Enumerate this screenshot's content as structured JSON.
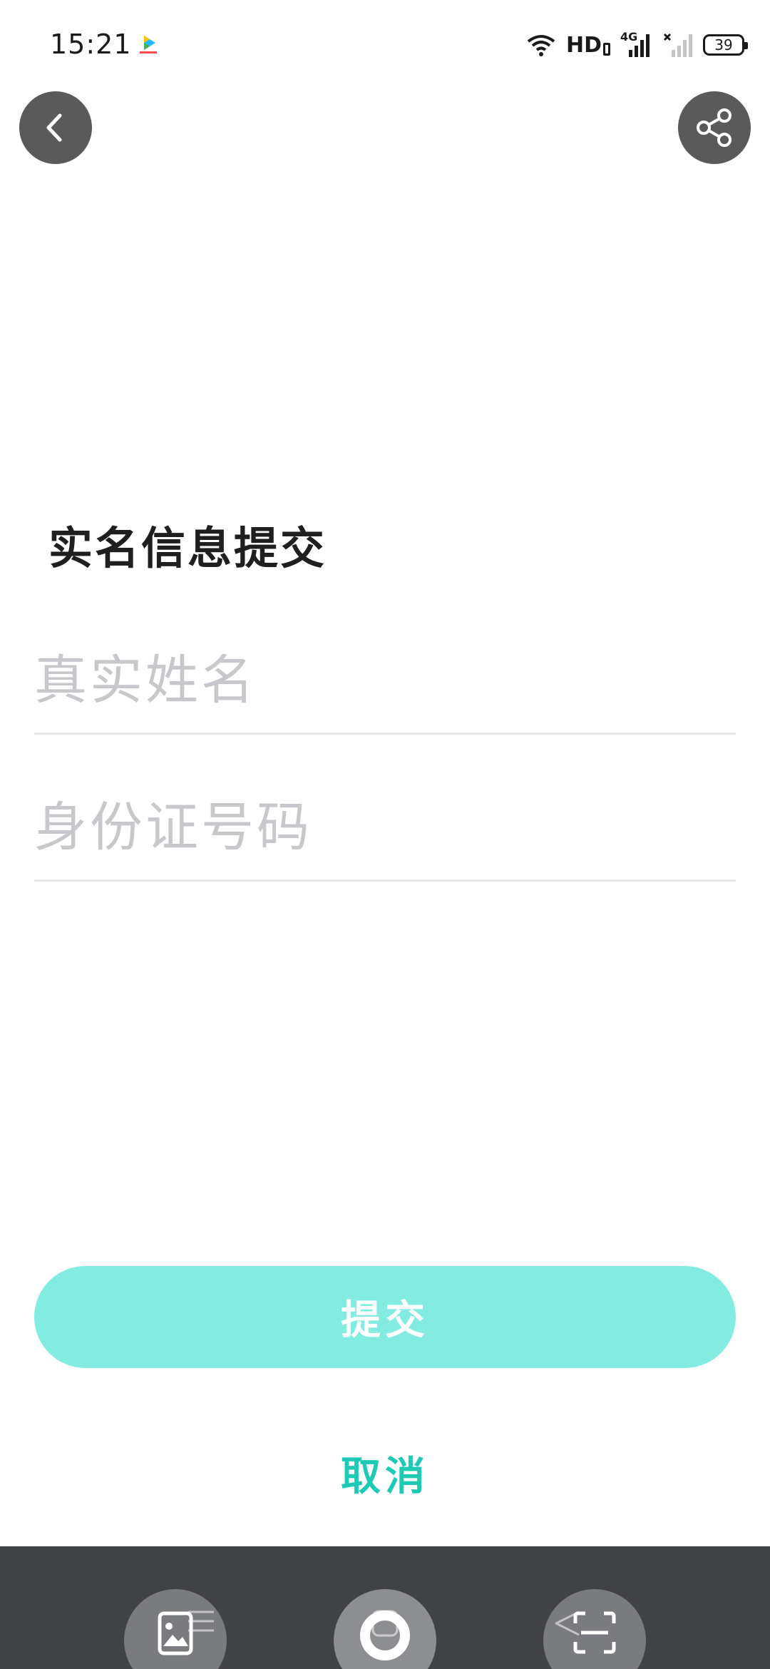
{
  "status_bar": {
    "time": "15:21",
    "hd_label": "HD",
    "network_label": "4G",
    "battery_level": "39",
    "icons": [
      "video-app-notification-icon",
      "wifi-icon",
      "signal-4g-icon",
      "signal-no-sim-icon",
      "battery-icon"
    ]
  },
  "header": {
    "back_icon": "chevron-left-icon",
    "share_icon": "share-icon"
  },
  "form": {
    "title": "实名信息提交",
    "name_field": {
      "value": "",
      "placeholder": "真实姓名"
    },
    "id_field": {
      "value": "",
      "placeholder": "身份证号码"
    },
    "submit_label": "提交",
    "cancel_label": "取消"
  },
  "colors": {
    "submit_bg": "#83ece0",
    "cancel_text": "#1ec9b6",
    "placeholder": "#c6c8cc",
    "toolbar_bg": "#404245"
  },
  "bottom_toolbar": {
    "icons": [
      "gallery-icon",
      "shutter-icon",
      "scan-icon"
    ]
  }
}
